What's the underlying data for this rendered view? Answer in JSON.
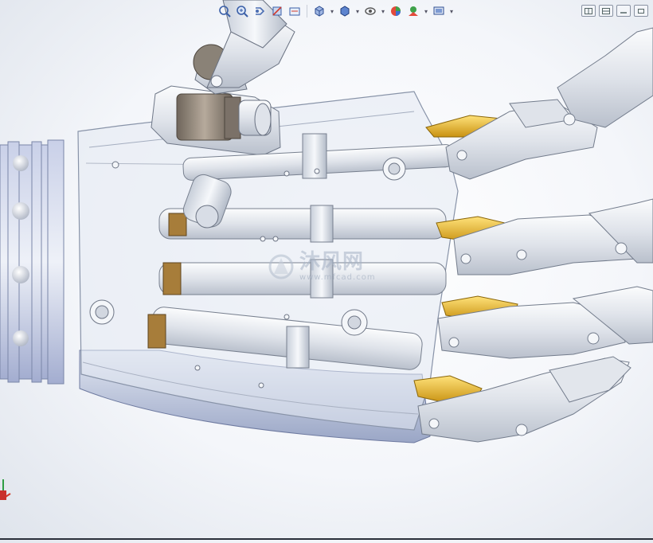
{
  "toolbar": {
    "tools": [
      {
        "name": "zoom-to-fit-icon"
      },
      {
        "name": "zoom-to-area-icon"
      },
      {
        "name": "previous-view-icon"
      },
      {
        "name": "section-view-icon"
      },
      {
        "name": "dynamic-annotation-icon"
      },
      {
        "name": "view-orientation-icon",
        "dropdown": true
      },
      {
        "name": "display-style-icon",
        "dropdown": true
      },
      {
        "name": "hide-show-items-icon",
        "dropdown": true
      },
      {
        "name": "edit-appearance-icon"
      },
      {
        "name": "apply-scene-icon",
        "dropdown": true
      },
      {
        "name": "view-settings-icon",
        "dropdown": true
      }
    ]
  },
  "window_controls": [
    {
      "name": "tile-horizontal-button"
    },
    {
      "name": "tile-vertical-button"
    },
    {
      "name": "minimize-button"
    },
    {
      "name": "restore-button"
    }
  ],
  "watermark": {
    "main": "沐风网",
    "sub": "www.mfcad.com"
  },
  "colors": {
    "metal_light": "#e6e9ef",
    "metal_mid": "#c3c9d4",
    "metal_dark": "#8d95a3",
    "glass": "#dfe6f2",
    "base_blue": "#b9c3de",
    "gold": "#e8b81e",
    "bronze": "#8f8478"
  }
}
